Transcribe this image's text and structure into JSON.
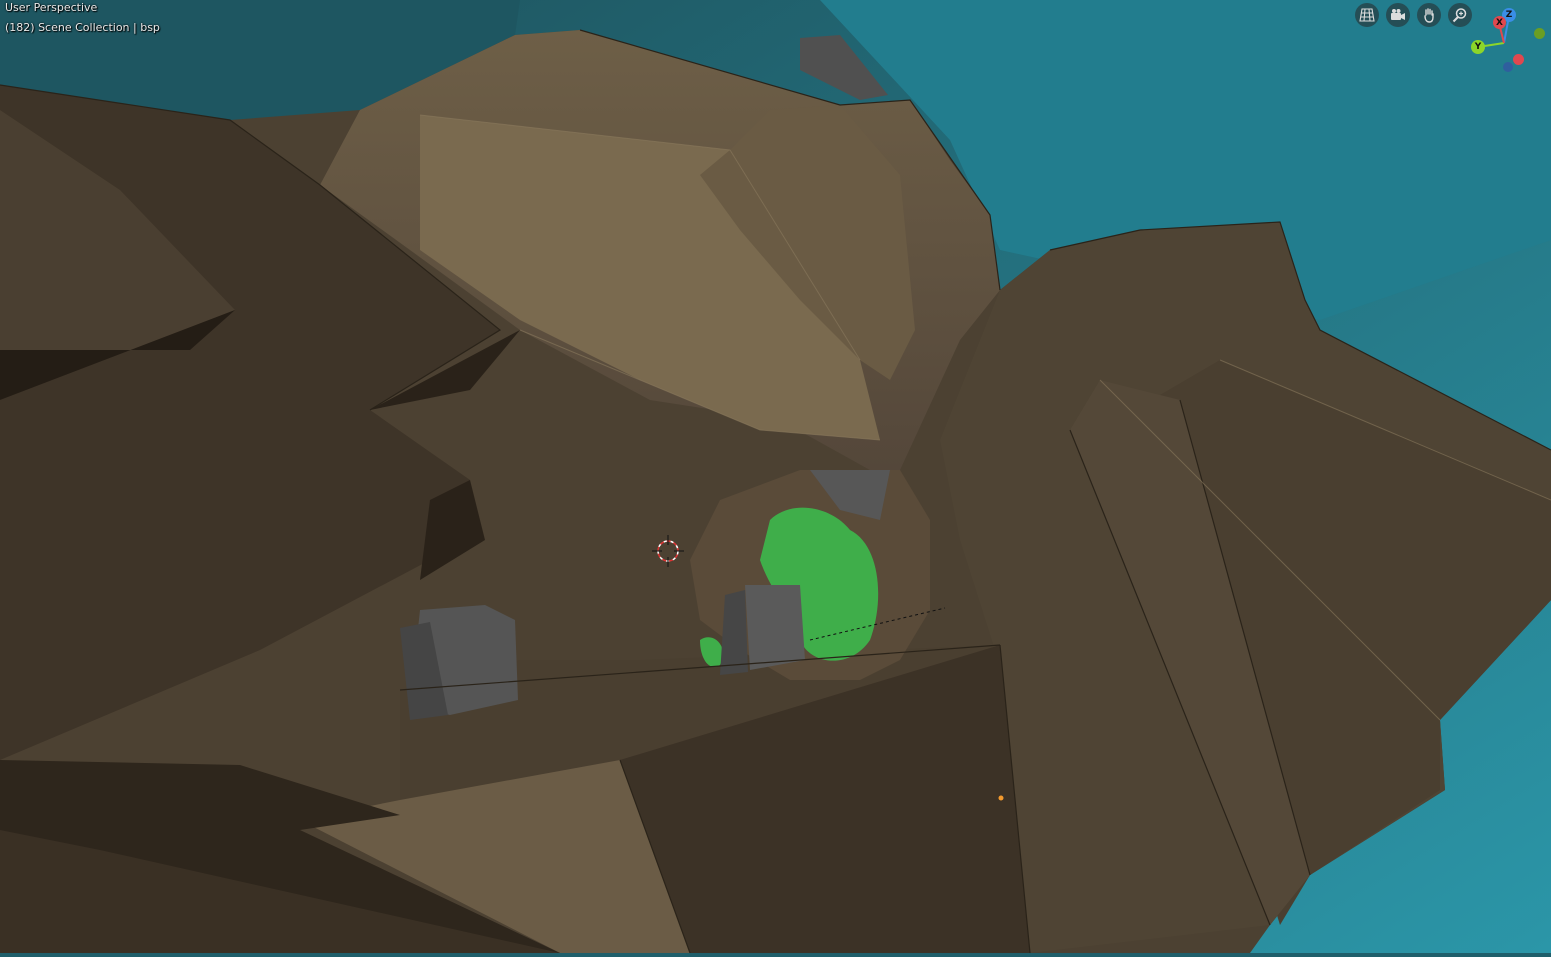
{
  "viewport": {
    "mode_label": "User Perspective",
    "collection_label": "(182) Scene Collection | bsp"
  },
  "nav_icons": [
    "grid-toggle-icon",
    "camera-view-icon",
    "pan-hand-icon",
    "zoom-icon"
  ],
  "gizmo": {
    "z_label": "Z",
    "x_label": "X",
    "y_label": "Y"
  },
  "colors": {
    "water": "#2a8a9c",
    "terrain_light": "#6b5c45",
    "terrain_dark": "#3f3426",
    "rock_gray": "#585858",
    "foliage_green": "#3fae4a",
    "axis_z": "#3a8ee6",
    "axis_x": "#e0484f",
    "axis_y": "#8cd62a"
  }
}
